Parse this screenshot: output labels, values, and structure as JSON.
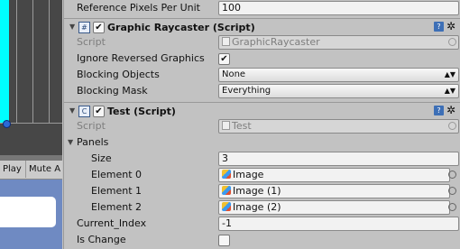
{
  "left_panel": {
    "toolbar": {
      "play_label": "Play",
      "mute_label": "Mute A"
    }
  },
  "inspector": {
    "reference_pixels": {
      "label": "Reference Pixels Per Unit",
      "value": "100"
    },
    "graphic_raycaster": {
      "title": "Graphic Raycaster (Script)",
      "enabled": true,
      "script_label": "Script",
      "script_value": "GraphicRaycaster",
      "ignore_reversed": {
        "label": "Ignore Reversed Graphics",
        "checked": true
      },
      "blocking_objects": {
        "label": "Blocking Objects",
        "value": "None"
      },
      "blocking_mask": {
        "label": "Blocking Mask",
        "value": "Everything"
      }
    },
    "test": {
      "title": "Test (Script)",
      "enabled": true,
      "script_label": "Script",
      "script_value": "Test",
      "panels": {
        "label": "Panels",
        "size_label": "Size",
        "size_value": "3",
        "elements": [
          {
            "label": "Element 0",
            "value": "Image"
          },
          {
            "label": "Element 1",
            "value": "Image (1)"
          },
          {
            "label": "Element 2",
            "value": "Image (2)"
          }
        ]
      },
      "current_index": {
        "label": "Current_Index",
        "value": "-1"
      },
      "is_change": {
        "label": "Is Change",
        "checked": false
      }
    }
  },
  "icons": {
    "fold_open": "triangle-down-icon",
    "help": "help-book-icon",
    "settings": "gear-icon",
    "script": "script-file-icon",
    "object_picker": "object-picker-circle-icon",
    "image": "image-asset-icon"
  }
}
